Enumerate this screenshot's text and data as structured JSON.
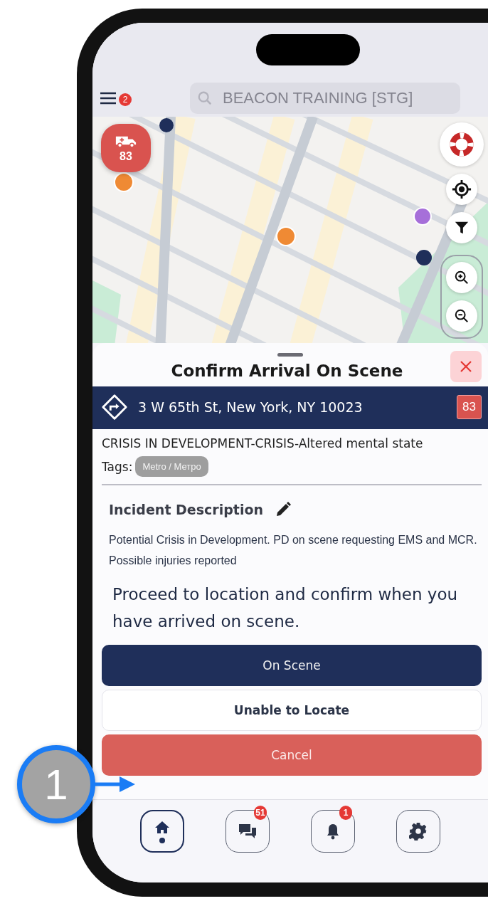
{
  "top_bar": {
    "menu_badge": "2",
    "search": {
      "placeholder": "BEACON TRAINING [STG]"
    }
  },
  "map": {
    "unit_marker": {
      "label": "83"
    }
  },
  "panel": {
    "title": "Confirm Arrival On Scene",
    "address": "3 W 65th St, New York, NY 10023",
    "unit_badge": "83",
    "incident_type": "CRISIS IN DEVELOPMENT-CRISIS-Altered mental state",
    "tags_label": "Tags:",
    "tags": [
      "Metro / Метро"
    ],
    "description_heading": "Incident Description",
    "description": "Potential Crisis in Development. PD on scene requesting EMS and MCR. Possible injuries reported",
    "instruction": "Proceed to location and confirm when you have arrived on scene.",
    "buttons": [
      {
        "label": "On Scene",
        "kind": "primary"
      },
      {
        "label": "Unable to Locate",
        "kind": "secondary"
      },
      {
        "label": "Cancel",
        "kind": "danger"
      }
    ]
  },
  "nav": [
    {
      "kind": "home",
      "selected": true
    },
    {
      "kind": "chat",
      "badge": "51",
      "selected": false
    },
    {
      "kind": "bell",
      "badge": "1",
      "selected": false
    },
    {
      "kind": "gear",
      "selected": false
    }
  ],
  "annotation": {
    "number": "1"
  }
}
